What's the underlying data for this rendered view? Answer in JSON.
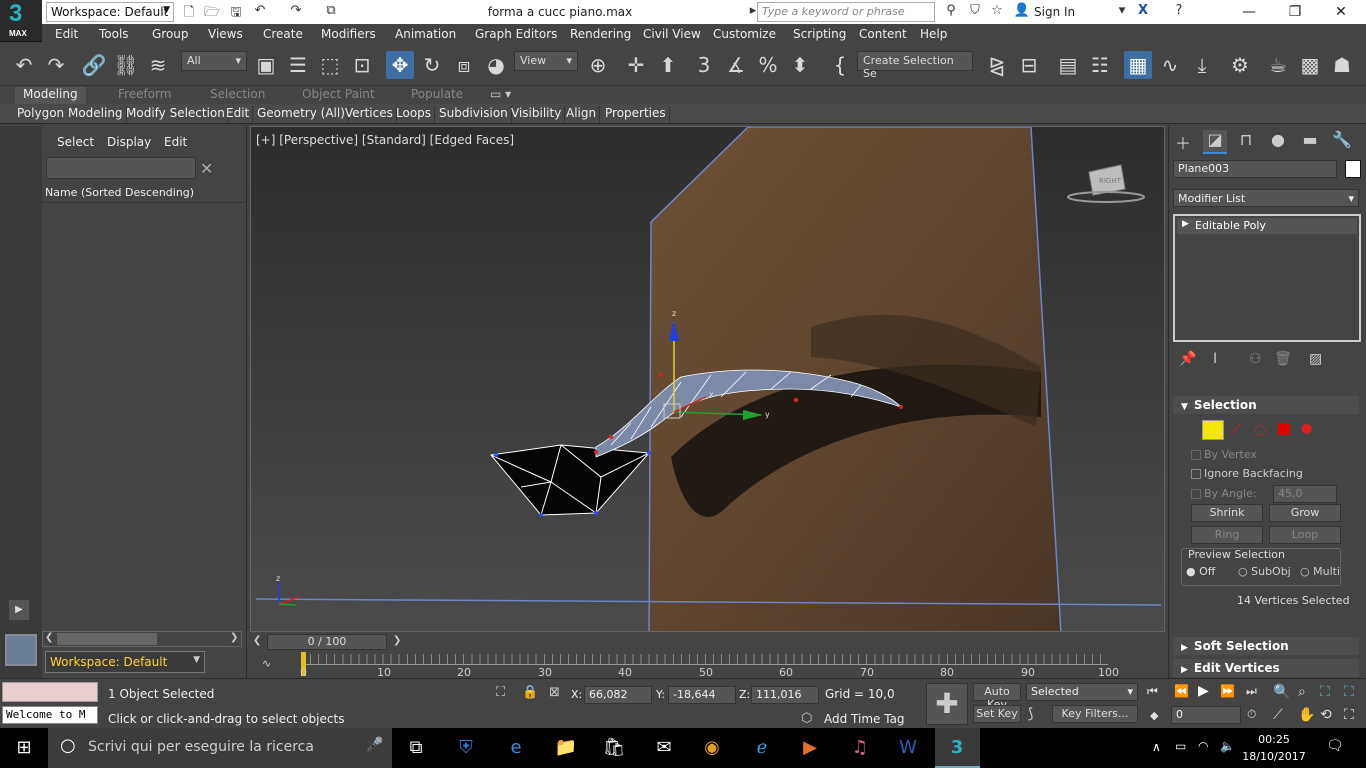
{
  "titlebar": {
    "logo_number": "3",
    "logo_text": "MAX",
    "workspace": "Workspace: Default",
    "document_title": "forma a cucc piano.max",
    "search_placeholder": "Type a keyword or phrase",
    "sign_in": "Sign In"
  },
  "menu": [
    "Edit",
    "Tools",
    "Group",
    "Views",
    "Create",
    "Modifiers",
    "Animation",
    "Graph Editors",
    "Rendering",
    "Civil View",
    "Customize",
    "Scripting",
    "Content",
    "Help"
  ],
  "toolbar": {
    "selection_filter": "All",
    "reference_coord": "View",
    "named_selection": "Create Selection Se"
  },
  "ribbon": {
    "tabs": [
      "Modeling",
      "Freeform",
      "Selection",
      "Object Paint",
      "Populate"
    ],
    "active_tab": "Modeling",
    "panels": [
      "Polygon Modeling",
      "Modify Selection",
      "Edit",
      "Geometry (All)",
      "Vertices",
      "Loops",
      "Subdivision",
      "Visibility",
      "Align",
      "Properties"
    ]
  },
  "explorer": {
    "tabs": [
      "Select",
      "Display",
      "Edit"
    ],
    "column_header": "Name (Sorted Descending)",
    "workspace": "Workspace: Default"
  },
  "viewport": {
    "label": "[+] [Perspective] [Standard] [Edged Faces]",
    "viewcube_face": "RIGHT",
    "gizmo_axes": [
      "x",
      "y",
      "z"
    ]
  },
  "command_panel": {
    "object_name": "Plane003",
    "object_color": "#ffffff",
    "modifier_list": "Modifier List",
    "stack_item": "Editable Poly",
    "selection_section": "Selection",
    "by_vertex": "By Vertex",
    "ignore_backfacing": "Ignore Backfacing",
    "by_angle_label": "By Angle:",
    "by_angle_value": "45,0",
    "shrink": "Shrink",
    "grow": "Grow",
    "ring": "Ring",
    "loop": "Loop",
    "preview_selection": "Preview Selection",
    "preview_options": [
      "Off",
      "SubObj",
      "Multi"
    ],
    "preview_selected": "Off",
    "selected_count": "14 Vertices Selected",
    "soft_selection": "Soft Selection",
    "edit_vertices": "Edit Vertices"
  },
  "timeline": {
    "slider": "0 / 100",
    "ticks": [
      "0",
      "10",
      "20",
      "30",
      "40",
      "50",
      "60",
      "70",
      "80",
      "90",
      "100"
    ]
  },
  "status": {
    "objects_selected": "1 Object Selected",
    "prompt": "Click or click-and-drag to select objects",
    "listener": "Welcome to M",
    "x_label": "X:",
    "x_value": "66,082",
    "y_label": "Y:",
    "y_value": "-18,644",
    "z_label": "Z:",
    "z_value": "111,016",
    "grid": "Grid = 10,0",
    "add_time_tag": "Add Time Tag",
    "auto_key": "Auto Key",
    "set_key": "Set Key",
    "key_mode": "Selected",
    "key_filters": "Key Filters...",
    "frame": "0"
  },
  "taskbar": {
    "search_placeholder": "Scrivi qui per eseguire la ricerca",
    "time": "00:25",
    "date": "18/10/2017"
  }
}
